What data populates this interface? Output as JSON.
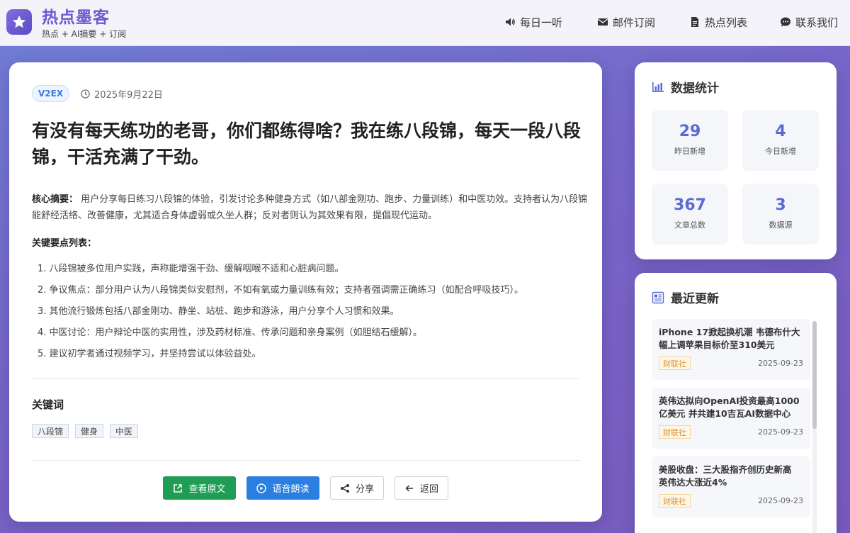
{
  "brand": {
    "title": "热点墨客",
    "subtitle": "热点 + AI摘要 + 订阅"
  },
  "nav": [
    {
      "label": "每日一听",
      "icon": "speaker-icon"
    },
    {
      "label": "邮件订阅",
      "icon": "mail-icon"
    },
    {
      "label": "热点列表",
      "icon": "document-icon"
    },
    {
      "label": "联系我们",
      "icon": "chat-icon"
    }
  ],
  "article": {
    "source": "V2EX",
    "date": "2025年9月22日",
    "title": "有没有每天练功的老哥，你们都练得啥？我在练八段锦，每天一段八段锦，干活充满了干劲。",
    "summary_label": "核心摘要：",
    "summary": "用户分享每日练习八段锦的体验，引发讨论多种健身方式（如八部金刚功、跑步、力量训练）和中医功效。支持者认为八段锦能舒经活络、改善健康，尤其适合身体虚弱或久坐人群；反对者则认为其效果有限，提倡现代运动。",
    "points_label": "关键要点列表：",
    "points": [
      "1. 八段锦被多位用户实践，声称能增强干劲、缓解咽喉不适和心脏病问题。",
      "2. 争议焦点：部分用户认为八段锦类似安慰剂，不如有氧或力量训练有效；支持者强调需正确练习（如配合呼吸技巧）。",
      "3. 其他流行锻炼包括八部金刚功、静坐、站桩、跑步和游泳，用户分享个人习惯和效果。",
      "4. 中医讨论：用户辩论中医的实用性，涉及药材标准、传承问题和亲身案例（如胆结石缓解）。",
      "5. 建议初学者通过视频学习，并坚持尝试以体验益处。"
    ],
    "keywords_title": "关键词",
    "keywords": [
      "八段锦",
      "健身",
      "中医"
    ],
    "buttons": {
      "original": "查看原文",
      "voice": "语音朗读",
      "share": "分享",
      "back": "返回"
    }
  },
  "stats": {
    "title": "数据统计",
    "items": [
      {
        "value": "29",
        "label": "昨日新增"
      },
      {
        "value": "4",
        "label": "今日新增"
      },
      {
        "value": "367",
        "label": "文章总数"
      },
      {
        "value": "3",
        "label": "数据源"
      }
    ]
  },
  "recent": {
    "title": "最近更新",
    "items": [
      {
        "title": "iPhone 17掀起换机潮 韦德布什大幅上调苹果目标价至310美元",
        "tag": "财联社",
        "date": "2025-09-23"
      },
      {
        "title": "英伟达拟向OpenAI投资最高1000亿美元 并共建10吉瓦AI数据中心",
        "tag": "财联社",
        "date": "2025-09-23"
      },
      {
        "title": "美股收盘：三大股指齐创历史新高 英伟达大涨近4%",
        "tag": "财联社",
        "date": "2025-09-23"
      }
    ]
  },
  "colors": {
    "accent": "#6a5ad2",
    "green": "#1f9d55",
    "blue": "#2b7fe0",
    "stat_num": "#5b6bd3"
  }
}
